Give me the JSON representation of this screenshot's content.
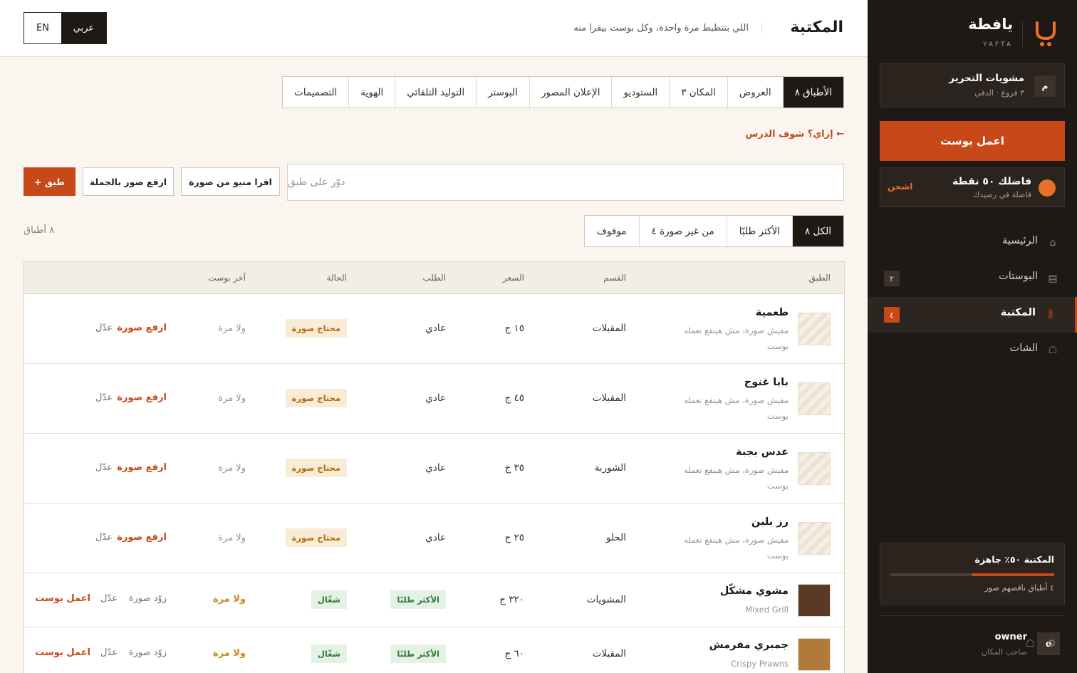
{
  "header": {
    "title": "المكتبة",
    "subtitle": "اللي بتتظبط مرة واحدة، وكل بوست بيقرا منه",
    "lang_en": "EN",
    "lang_ar": "عربي"
  },
  "tabs": [
    {
      "label": "الأطباق ٨",
      "active": true
    },
    {
      "label": "العروض"
    },
    {
      "label": "المكان ٣"
    },
    {
      "label": "الستوديو"
    },
    {
      "label": "الإعلان المصور"
    },
    {
      "label": "البوستر"
    },
    {
      "label": "التوليد التلقائي"
    },
    {
      "label": "الهوية"
    },
    {
      "label": "التصميمات"
    }
  ],
  "lesson_link": "إزاي؟ شوف الدرس ←",
  "search": {
    "placeholder": "دوّر على طبق"
  },
  "actions": {
    "ocr": "اقرا منيو من صورة",
    "bulk": "ارفع صور بالجملة",
    "add": "+ طبق"
  },
  "filters": [
    {
      "label": "الكل ٨",
      "active": true
    },
    {
      "label": "الأكثر طلبًا"
    },
    {
      "label": "من غير صورة ٤"
    },
    {
      "label": "موقوف"
    }
  ],
  "count_label": "٨ أطباق",
  "table": {
    "headers": {
      "dish": "الطبق",
      "category": "القسم",
      "price": "السعر",
      "demand": "الطلب",
      "status": "الحالة",
      "last_post": "آخر بوست"
    },
    "rows": [
      {
        "name": "طعمية",
        "note": "مفيش صورة، مش هينفع نعمله بوست",
        "category": "المقبلات",
        "price": "١٥ ج",
        "demand": "عادي",
        "status": "محتاج صورة",
        "last": "ولا مرة",
        "act1": "ارفع صورة",
        "act2": "عدّل"
      },
      {
        "name": "بابا غنوج",
        "note": "مفيش صورة، مش هينفع نعمله بوست",
        "category": "المقبلات",
        "price": "٤٥ ج",
        "demand": "عادي",
        "status": "محتاج صورة",
        "last": "ولا مرة",
        "act1": "ارفع صورة",
        "act2": "عدّل"
      },
      {
        "name": "عدس بجبة",
        "note": "مفيش صورة، مش هينفع نعمله بوست",
        "category": "الشوربة",
        "price": "٣٥ ج",
        "demand": "عادي",
        "status": "محتاج صورة",
        "last": "ولا مرة",
        "act1": "ارفع صورة",
        "act2": "عدّل"
      },
      {
        "name": "رز بلبن",
        "note": "مفيش صورة، مش هينفع نعمله بوست",
        "category": "الحلو",
        "price": "٢٥ ج",
        "demand": "عادي",
        "status": "محتاج صورة",
        "last": "ولا مرة",
        "act1": "ارفع صورة",
        "act2": "عدّل"
      },
      {
        "name": "مشوي مشكّل",
        "sub": "Mixed Grill",
        "category": "المشويات",
        "price": "٣٢٠ ج",
        "demand": "الأكثر طلبًا",
        "status": "شغّال",
        "last": "ولا مرة",
        "act0": "اعمل بوست",
        "act1": "زوّد صورة",
        "act2": "عدّل"
      },
      {
        "name": "جمبري مقرمش",
        "sub": "Crispy Prawns",
        "category": "المقبلات",
        "price": "٦٠ ج",
        "demand": "الأكثر طلبًا",
        "status": "شغّال",
        "last": "ولا مرة",
        "act0": "اعمل بوست",
        "act1": "زوّد صورة",
        "act2": "عدّل"
      }
    ]
  },
  "sidebar": {
    "logo_ar": "يافطة",
    "logo_en": "YAFTA",
    "drafts": {
      "icon": "م",
      "title": "مشويات التحرير",
      "sub": "٣ فروع · الدقي"
    },
    "make_post": "اعمل بوست",
    "points": {
      "title": "فاضلك ٥٠ نقطة",
      "sub": "فاضلة في رصيدك",
      "charge": "اشحن"
    },
    "nav": [
      {
        "label": "الرئيسية",
        "icon": "home-icon"
      },
      {
        "label": "البوستات",
        "badge": "٢",
        "icon": "posts-icon"
      },
      {
        "label": "المكتبة",
        "badge": "٤",
        "active": true,
        "icon": "library-icon"
      },
      {
        "label": "الشات",
        "icon": "chat-icon"
      }
    ],
    "library_status": {
      "title": "المكتبة ٥٠٪ جاهزة",
      "progress": 0.5,
      "sub": "٤ أطباق ناقصهم صور"
    },
    "user": {
      "avatar": "o",
      "name": "owner",
      "role": "صاحب المكان"
    }
  }
}
